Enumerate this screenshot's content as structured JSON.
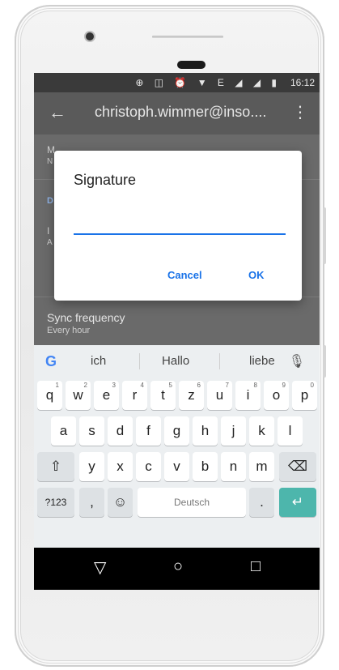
{
  "status": {
    "icons": "⊕ ◫ ⏰ ▼ E ◢ ◢ ▮",
    "time": "16:12"
  },
  "toolbar": {
    "back_glyph": "←",
    "title": "christoph.wimmer@inso....",
    "more_glyph": "⋮"
  },
  "settings": {
    "peek1": "M",
    "peek1b": "N",
    "peek2": "D",
    "peek3": "I",
    "peek3b": "A",
    "sync_title": "Sync frequency",
    "sync_subtitle": "Every hour"
  },
  "dialog": {
    "title": "Signature",
    "input_value": "",
    "cancel_label": "Cancel",
    "ok_label": "OK",
    "accent_color": "#1a73e8"
  },
  "keyboard": {
    "google_glyph": "G",
    "suggestions": [
      "ich",
      "Hallo",
      "liebe"
    ],
    "mic_glyph": "🎙",
    "row1": [
      {
        "k": "q",
        "h": "1"
      },
      {
        "k": "w",
        "h": "2"
      },
      {
        "k": "e",
        "h": "3"
      },
      {
        "k": "r",
        "h": "4"
      },
      {
        "k": "t",
        "h": "5"
      },
      {
        "k": "z",
        "h": "6"
      },
      {
        "k": "u",
        "h": "7"
      },
      {
        "k": "i",
        "h": "8"
      },
      {
        "k": "o",
        "h": "9"
      },
      {
        "k": "p",
        "h": "0"
      }
    ],
    "row2": [
      "a",
      "s",
      "d",
      "f",
      "g",
      "h",
      "j",
      "k",
      "l"
    ],
    "row3": [
      "y",
      "x",
      "c",
      "v",
      "b",
      "n",
      "m"
    ],
    "shift_glyph": "⇧",
    "backspace_glyph": "⌫",
    "sym_label": "?123",
    "comma_label": ",",
    "emoji_glyph": "☺",
    "space_label": "Deutsch",
    "period_label": ".",
    "enter_glyph": "↵",
    "enter_color": "#4db6ac"
  },
  "navbar": {
    "back_glyph": "▽",
    "home_glyph": "○",
    "recents_glyph": "□"
  }
}
